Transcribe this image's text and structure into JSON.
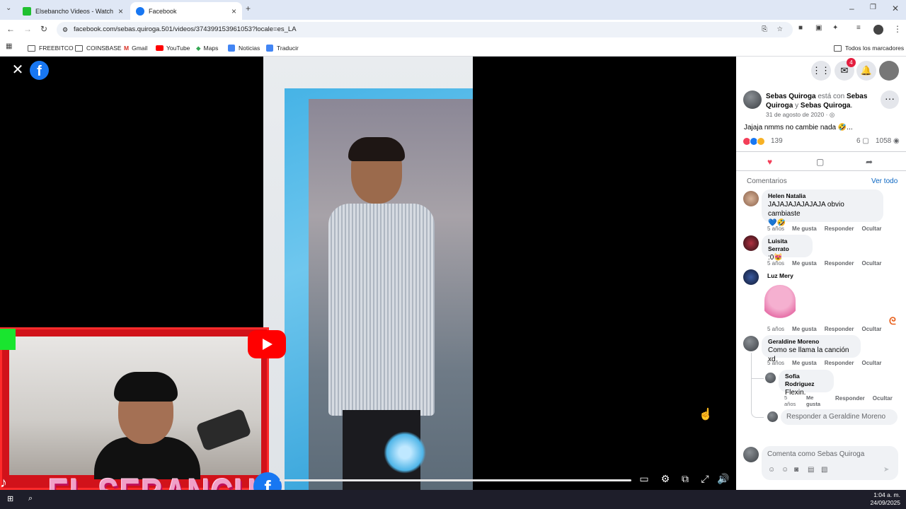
{
  "browser": {
    "tabs": [
      {
        "title": "Elsebancho Videos - Watch On",
        "active": false
      },
      {
        "title": "Facebook",
        "active": true
      }
    ],
    "url": "facebook.com/sebas.quiroga.501/videos/374399153961053?locale=es_LA",
    "bookmarks": [
      "FREEBITCO",
      "COINSBASE",
      "Gmail",
      "YouTube",
      "Maps",
      "Noticias",
      "Traducir"
    ],
    "all_bookmarks": "Todos los marcadores"
  },
  "video": {
    "overlay_text": "EL SEBANCHO",
    "progress": 0.0
  },
  "fb": {
    "notif_count": "4"
  },
  "post": {
    "author": "Sebas Quiroga",
    "with_text": "está con",
    "tag1": "Sebas Quiroga",
    "and_text": "y",
    "tag2": "Sebas Quiroga",
    "date": "31 de agosto de 2020",
    "text": "Jajaja nmms no cambie nada 🤣...",
    "reactions_count": "139",
    "comments_count": "6",
    "views": "1058"
  },
  "comments": {
    "header": "Comentarios",
    "see_all": "Ver todo",
    "like": "Me gusta",
    "reply": "Responder",
    "hide": "Ocultar",
    "items": [
      {
        "name": "Helen Natalia",
        "text": "JAJAJAJAJAJAJA obvio cambiaste",
        "emoji": "💙🤣",
        "age": "5 años"
      },
      {
        "name": "Luisita Serrato",
        "text": ":0😻",
        "age": "5 años"
      },
      {
        "name": "Luz Mery",
        "text": "",
        "age": "5 años"
      },
      {
        "name": "Geraldine Moreno",
        "text": "Como se llama la canción xd",
        "age": "5 años"
      },
      {
        "name": "Sofia Rodriguez",
        "text": "Flexin.",
        "age": "5 años"
      }
    ],
    "reply_placeholder": "Responder a Geraldine Moreno",
    "compose_placeholder": "Comenta como Sebas Quiroga"
  },
  "taskbar": {
    "time": "1:04 a. m.",
    "date": "24/09/2025"
  }
}
